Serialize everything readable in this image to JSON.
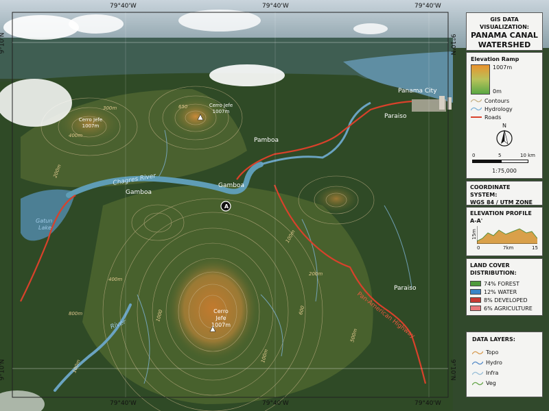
{
  "title_line1": "GIS DATA VISUALIZATION:",
  "title_line2": "PANAMA CANAL",
  "title_line3": "WATERSHED",
  "coords": {
    "top": [
      "79°40'W",
      "79°40'W",
      "79°40'W"
    ],
    "bottom": [
      "79°40'W",
      "79°40'W",
      "79°40'W"
    ],
    "left_top": "9°10'N",
    "left_bottom": "9°10'N",
    "right_top": "9°10'N",
    "right_bottom": "9°10'N"
  },
  "elevation_ramp": {
    "title": "Elevation Ramp",
    "max": "1007m",
    "min": "0m",
    "high_color": "#e9932d",
    "low_color": "#5aa844"
  },
  "legend_lines": [
    {
      "label": "Contours",
      "color": "#c8b48a"
    },
    {
      "label": "Hydrology",
      "color": "#7fb4d8"
    },
    {
      "label": "Roads",
      "color": "#d9412b"
    }
  ],
  "scale": {
    "north": "N",
    "ticks": [
      "0",
      "5",
      "10 km"
    ],
    "ratio": "1:75,000"
  },
  "coordinate_system": {
    "line1": "COORDINATE SYSTEM:",
    "line2": "WGS 84 / UTM ZONE 17N"
  },
  "profile": {
    "title": "ELEVATION PROFILE",
    "subtitle": "A-A'",
    "y_label": "15m",
    "x_ticks": [
      "0",
      "7km",
      "15"
    ]
  },
  "land_cover": {
    "title1": "LAND COVER",
    "title2": "DISTRIBUTION:",
    "items": [
      {
        "label": "74% FOREST",
        "color": "#4f9a3c"
      },
      {
        "label": "12% WATER",
        "color": "#3a86c8"
      },
      {
        "label": "8% DEVELOPED",
        "color": "#c83b34"
      },
      {
        "label": "6% AGRICULTURE",
        "color": "#e9787a"
      }
    ]
  },
  "data_layers": {
    "title": "DATA LAYERS:",
    "items": [
      {
        "label": "Topo",
        "color": "#d9a05a"
      },
      {
        "label": "Hydro",
        "color": "#5b8fc9"
      },
      {
        "label": "Infra",
        "color": "#9bc0d8"
      },
      {
        "label": "Veg",
        "color": "#6aa84f"
      }
    ]
  },
  "map_labels": {
    "panama_city": "Panama City",
    "paraiso_top": "Paraiso",
    "paraiso_right": "Paraiso",
    "pamboa": "Pamboa",
    "gamboa_center": "Gamboa",
    "gamboa_left": "Gamboa",
    "chagres": "Chagres River",
    "river": "River",
    "gatun1": "Gatun",
    "gatun2": "Lake",
    "cerro_jefe_main1": "Cerro",
    "cerro_jefe_main2": "Jefe",
    "cerro_jefe_main3": "1007m",
    "cerro_jefe_left1": "Cerro Jefe",
    "cerro_jefe_left2": "1007m",
    "cerro_jefe_top1": "Cerro Jefe",
    "cerro_jefe_top2": "1007m",
    "highway": "Pan-American Highway",
    "marker_a": "A",
    "contour_labels": [
      "650",
      "400m",
      "300m",
      "200m",
      "800m",
      "100m",
      "400m",
      "1000",
      "600",
      "100m",
      "500m",
      "100m",
      "200m"
    ]
  }
}
